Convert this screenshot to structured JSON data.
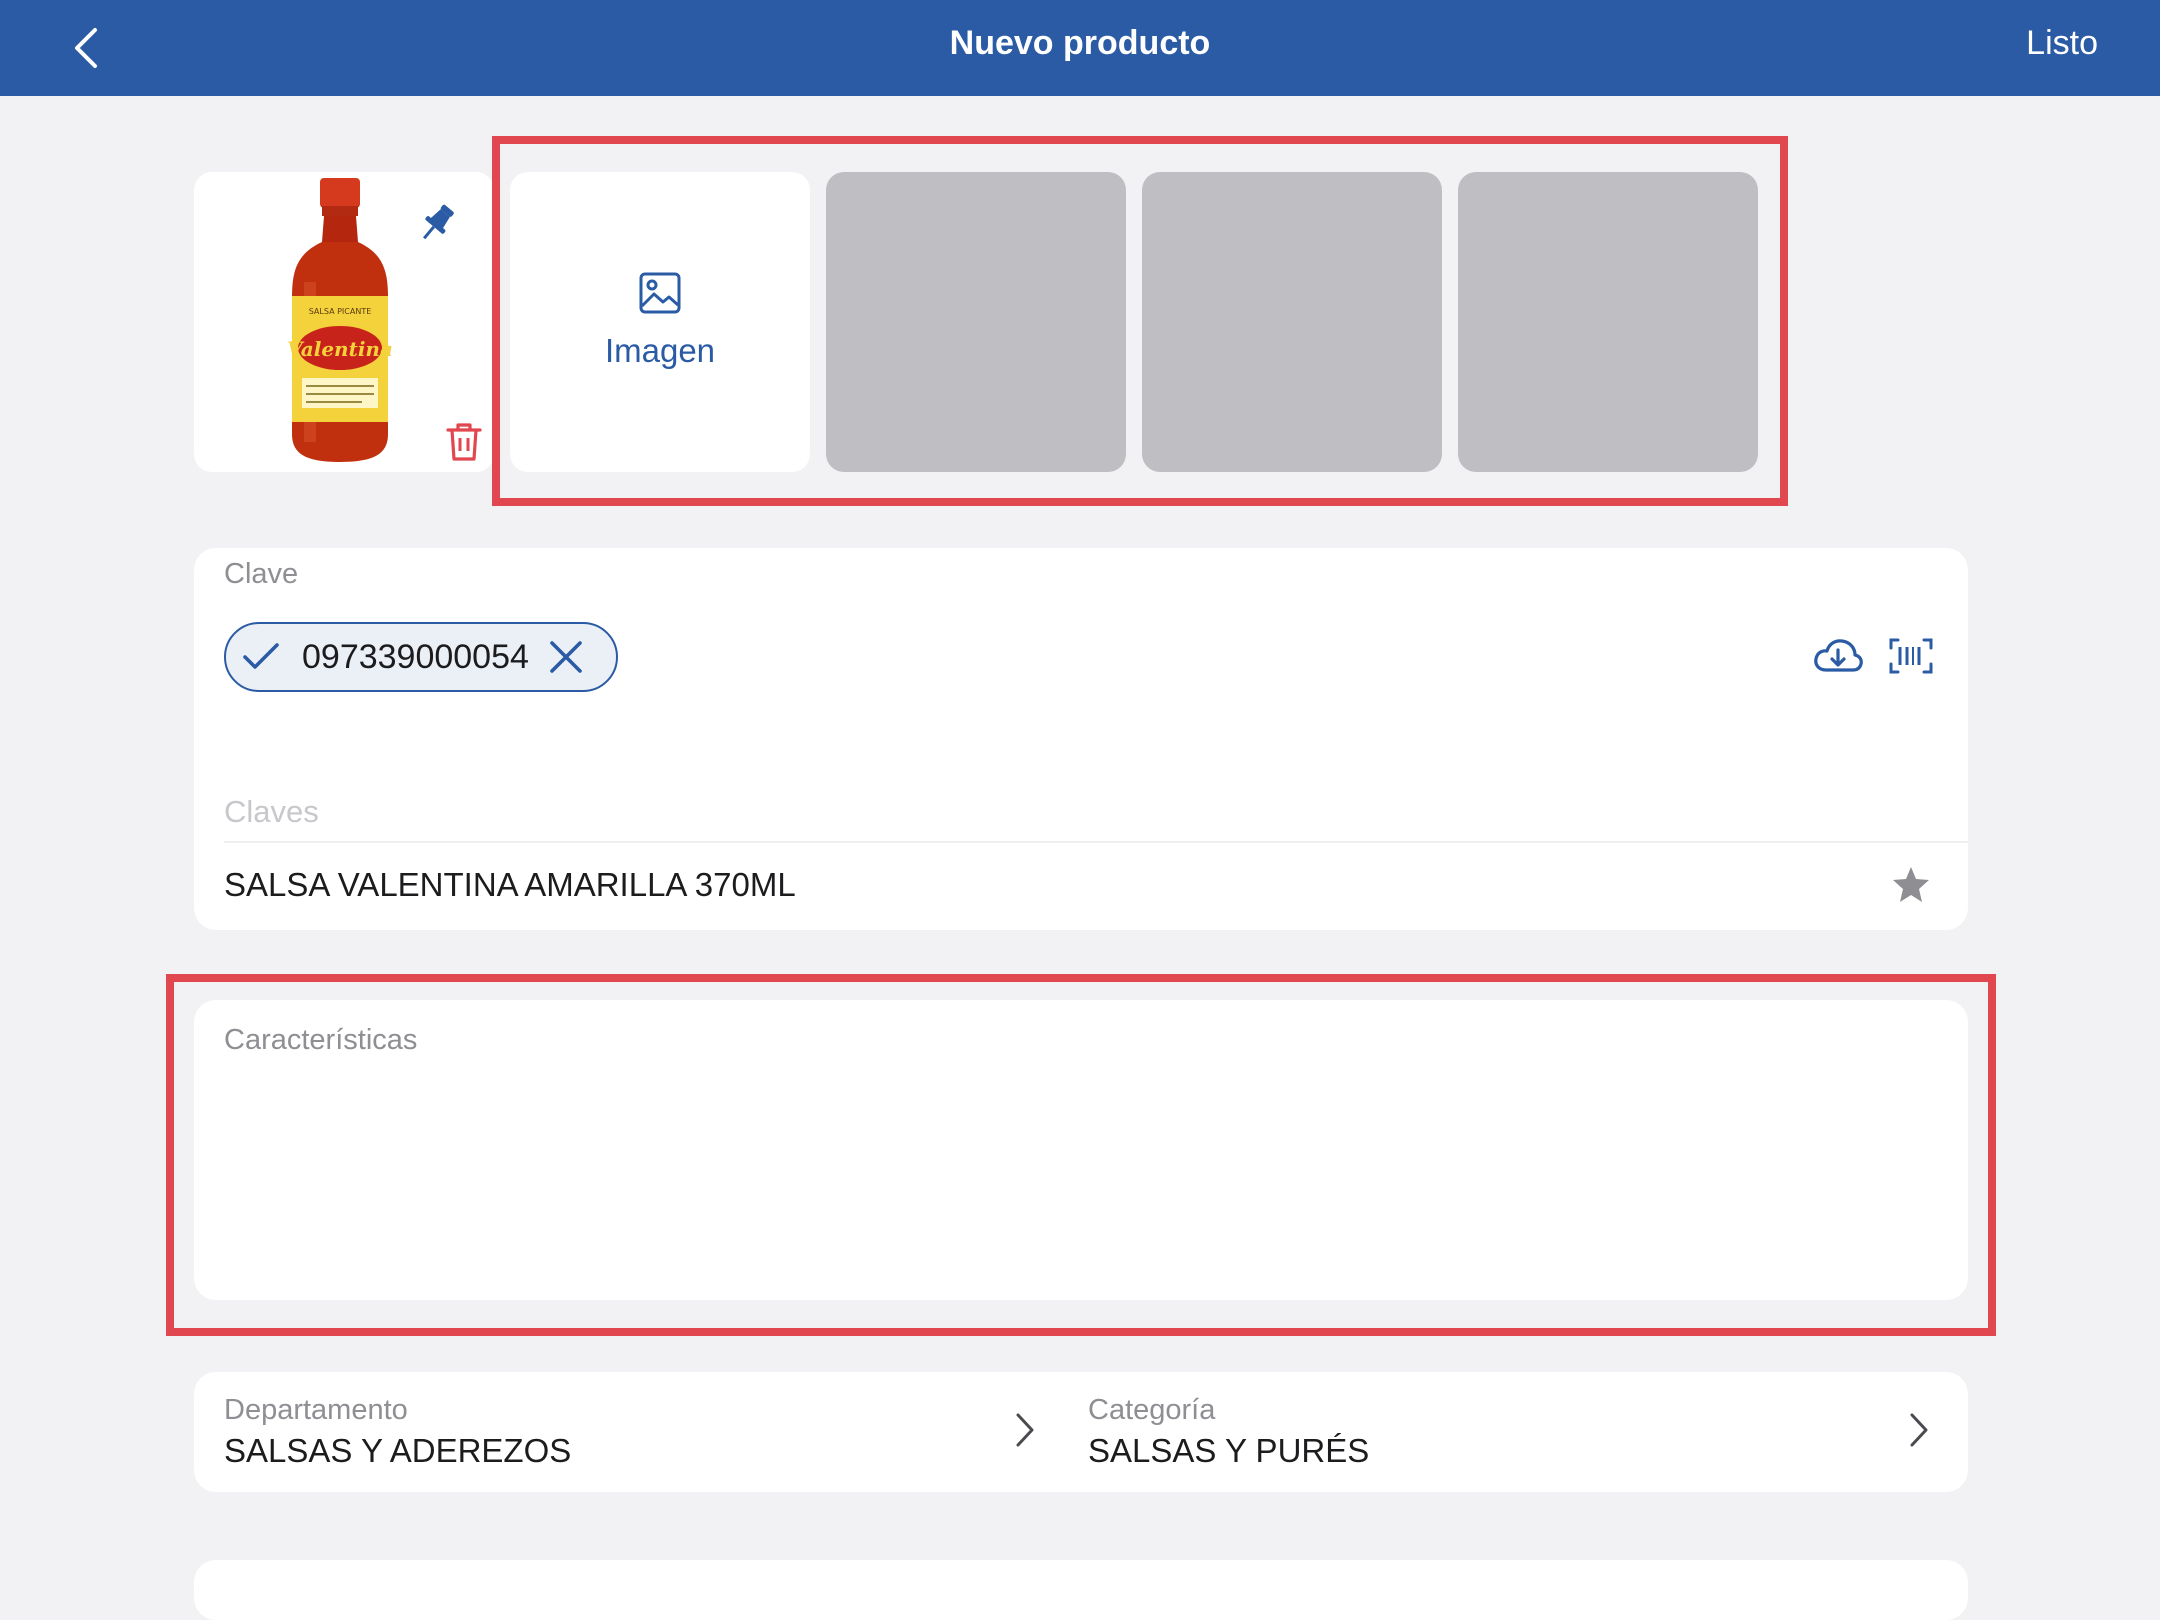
{
  "nav": {
    "title": "Nuevo producto",
    "done_label": "Listo"
  },
  "photos": {
    "add_label": "Imagen",
    "empty_slots": 3
  },
  "product_image": {
    "brand_text": "Valentina",
    "top_text": "SALSA PICANTE"
  },
  "clave": {
    "label": "Clave",
    "chip_value": "097339000054"
  },
  "claves": {
    "placeholder": "Claves",
    "name_value": "SALSA VALENTINA AMARILLA 370ML"
  },
  "caracteristicas": {
    "placeholder": "Características"
  },
  "classification": {
    "department_label": "Departamento",
    "department_value": "SALSAS Y ADEREZOS",
    "category_label": "Categoría",
    "category_value": "SALSAS Y PURÉS"
  },
  "colors": {
    "nav": "#2a5ba4",
    "accent": "#2a5ba4",
    "highlight": "#e1474f",
    "danger": "#e1474f",
    "background": "#f2f2f4"
  },
  "icons": [
    "back-chevron-icon",
    "pin-icon",
    "trash-icon",
    "image-icon",
    "check-icon",
    "close-icon",
    "cloud-download-icon",
    "barcode-scan-icon",
    "star-icon",
    "chevron-right-icon"
  ]
}
